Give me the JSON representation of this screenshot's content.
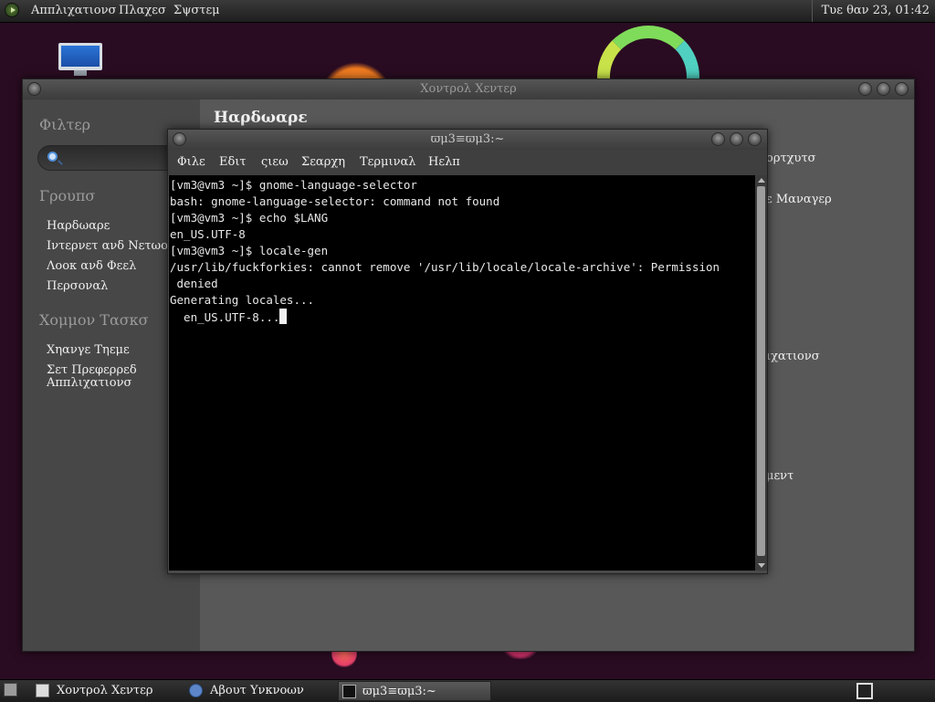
{
  "top_panel": {
    "menus": [
      "Αππλιχατιονσ",
      "Πλαχεσ",
      "Σψστεμ"
    ],
    "clock": "Τυε θαν 23, 01:42"
  },
  "control_center": {
    "title": "Χοντρολ Χεντερ",
    "filter_label": "Φιλτερ",
    "search_placeholder": "",
    "groups_label": "Γρουπσ",
    "groups": [
      "Ηαρδωαρε",
      "Ιντερνετ ανδ Νετωορκ",
      "Λοοκ ανδ Φεελ",
      "Περσοναλ"
    ],
    "common_tasks_label": "Χομμον Τασκσ",
    "tasks": [
      "Χηανγε Τηεμε",
      "Σετ Πρεφερρεδ",
      "Αππλιχατιονσ"
    ],
    "section_title": "Ηαρδωαρε",
    "peek_items": [
      "ορτχυτσ",
      "ε Μαναγερ",
      "ιχατιονσ",
      "μεντ"
    ]
  },
  "terminal": {
    "title": "ϖμ3≡ϖμ3:~",
    "menu": [
      "Φιλε",
      "Εδιτ",
      "ςιεω",
      "Σεαρχη",
      "Τερμιναλ",
      "Ηελπ"
    ],
    "lines": [
      "[vm3@vm3 ~]$ gnome-language-selector",
      "bash: gnome-language-selector: command not found",
      "[vm3@vm3 ~]$ echo $LANG",
      "en_US.UTF-8",
      "[vm3@vm3 ~]$ locale-gen",
      "/usr/lib/fuckforkies: cannot remove '/usr/lib/locale/locale-archive': Permission",
      " denied",
      "Generating locales..."
    ],
    "current_line": "  en_US.UTF-8..."
  },
  "taskbar": {
    "tasks": [
      "Χοντρολ Χεντερ",
      "Αβουτ Υνκνοων",
      "ϖμ3≡ϖμ3:~"
    ]
  },
  "colors": {
    "desktop_bg": "#2a0c22",
    "terminal_bg": "#000000",
    "terminal_fg": "#e8e8e8",
    "panel_bg": "#2b2b2b"
  }
}
